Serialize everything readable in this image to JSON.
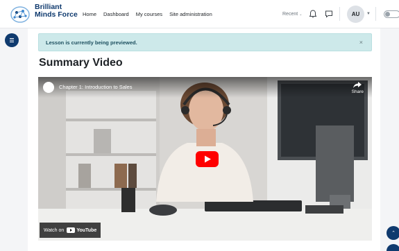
{
  "brand": {
    "line1": "Brilliant",
    "line2": "Minds Force"
  },
  "nav": {
    "links": [
      "Home",
      "Dashboard",
      "My courses",
      "Site administration"
    ],
    "recent": "Recent"
  },
  "user": {
    "initials": "AU"
  },
  "alert": {
    "message": "Lesson is currently being previewed.",
    "close": "×"
  },
  "page": {
    "title": "Summary Video"
  },
  "video": {
    "title": "Chapter 1: Introduction to Sales",
    "share": "Share",
    "watch_on": "Watch on",
    "platform": "YouTube"
  },
  "icons": [
    "menu-icon",
    "bell-icon",
    "chat-icon",
    "play-icon",
    "share-icon",
    "chevron-down-icon"
  ],
  "colors": {
    "brand": "#0f3a6e",
    "alert_bg": "#cde9ea",
    "play": "#ff0000"
  }
}
